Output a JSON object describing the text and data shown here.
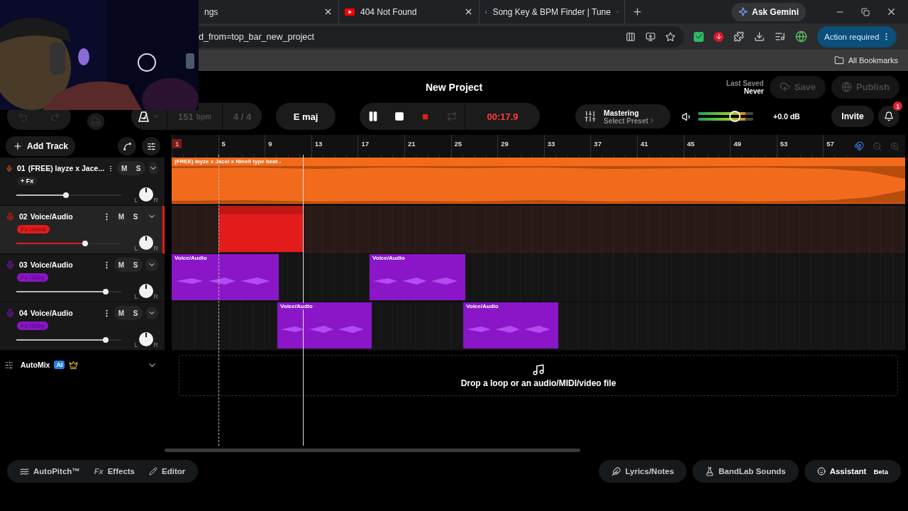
{
  "browser": {
    "tabs": [
      {
        "title": "ngs",
        "kind": "plain"
      },
      {
        "title": "404 Not Found",
        "kind": "video"
      },
      {
        "title": "Song Key & BPM Finder | Tune",
        "kind": "drop"
      }
    ],
    "ask_button": "Ask Gemini",
    "address": "d_from=top_bar_new_project",
    "action_button": "Action required",
    "bookmarks": "All Bookmarks"
  },
  "project": {
    "title": "New Project",
    "last_saved_label": "Last Saved",
    "last_saved_value": "Never",
    "save": {
      "label": "Save",
      "disabled": true
    },
    "publish": {
      "label": "Publish",
      "disabled": true
    }
  },
  "toolbar": {
    "bpm": "151",
    "bpm_unit": "bpm",
    "time_signature": "4 / 4",
    "key": "E maj",
    "playing": true,
    "time": "00:17.9",
    "mastering": "Mastering",
    "preset": "Select Preset",
    "volume": {
      "level": 0.67
    },
    "gain": "+0.0 dB",
    "invite": "Invite",
    "notifications": "1"
  },
  "add_track": "Add Track",
  "tracks": [
    {
      "number": "01",
      "name": "(FREE) layze x Jace...",
      "color": "#f26b1d",
      "selected": false,
      "fx": {
        "kind": "add",
        "label": "+ Fx"
      },
      "mute": "M",
      "solo": "S",
      "pan": {
        "left": "L",
        "right": "R"
      },
      "volume": {
        "level": 0.47
      },
      "clips": [
        {
          "label": "(FREE) layze x Jacel x Nine9 type beat -"
        }
      ]
    },
    {
      "number": "02",
      "name": "Voice/Audio",
      "color": "#e31b1b",
      "selected": true,
      "fx": {
        "kind": "preset",
        "label": "Fx new4"
      },
      "mute": "M",
      "solo": "S",
      "pan": {
        "left": "L",
        "right": "R"
      },
      "volume": {
        "level": 0.65
      },
      "clips": [
        {
          "kind": "plain"
        }
      ]
    },
    {
      "number": "03",
      "name": "Voice/Audio",
      "color": "#8a16c8",
      "selected": false,
      "fx": {
        "kind": "preset",
        "label": "Fx libby"
      },
      "mute": "M",
      "solo": "S",
      "pan": {
        "left": "L",
        "right": "R"
      },
      "volume": {
        "level": 0.85
      },
      "clips": [
        {
          "label": "Voice/Audio"
        },
        {
          "label": "Voice/Audio"
        }
      ]
    },
    {
      "number": "04",
      "name": "Voice/Audio",
      "color": "#8a16c8",
      "selected": false,
      "fx": {
        "kind": "preset",
        "label": "Fx libby"
      },
      "mute": "M",
      "solo": "S",
      "pan": {
        "left": "L",
        "right": "R"
      },
      "volume": {
        "level": 0.85
      },
      "clips": [
        {
          "label": "Voice/Audio"
        },
        {
          "label": "Voice/Audio"
        }
      ]
    }
  ],
  "automix": {
    "label": "AutoMix",
    "badge": "AI"
  },
  "ruler": [
    {
      "label": "1",
      "highlighted": true
    },
    {
      "label": "5",
      "highlighted": false
    },
    {
      "label": "9",
      "highlighted": false
    },
    {
      "label": "13",
      "highlighted": false
    },
    {
      "label": "17",
      "highlighted": false
    },
    {
      "label": "21",
      "highlighted": false
    },
    {
      "label": "25",
      "highlighted": false
    },
    {
      "label": "29",
      "highlighted": false
    },
    {
      "label": "33",
      "highlighted": false
    },
    {
      "label": "37",
      "highlighted": false
    },
    {
      "label": "41",
      "highlighted": false
    },
    {
      "label": "45",
      "highlighted": false
    },
    {
      "label": "49",
      "highlighted": false
    },
    {
      "label": "53",
      "highlighted": false
    },
    {
      "label": "57",
      "highlighted": false
    }
  ],
  "drop_zone": "Drop a loop or an audio/MIDI/video file",
  "bottom_bar": {
    "left": [
      {
        "kind": "autopitch",
        "label": "AutoPitch™"
      },
      {
        "kind": "fx",
        "prefix": "Fx",
        "label": "Effects"
      },
      {
        "kind": "editor",
        "label": "Editor"
      }
    ],
    "right": [
      {
        "kind": "lyrics",
        "label": "Lyrics/Notes"
      },
      {
        "kind": "sounds",
        "label": "BandLab Sounds"
      },
      {
        "kind": "assistant",
        "label": "Assistant",
        "badge": "Beta"
      }
    ]
  }
}
